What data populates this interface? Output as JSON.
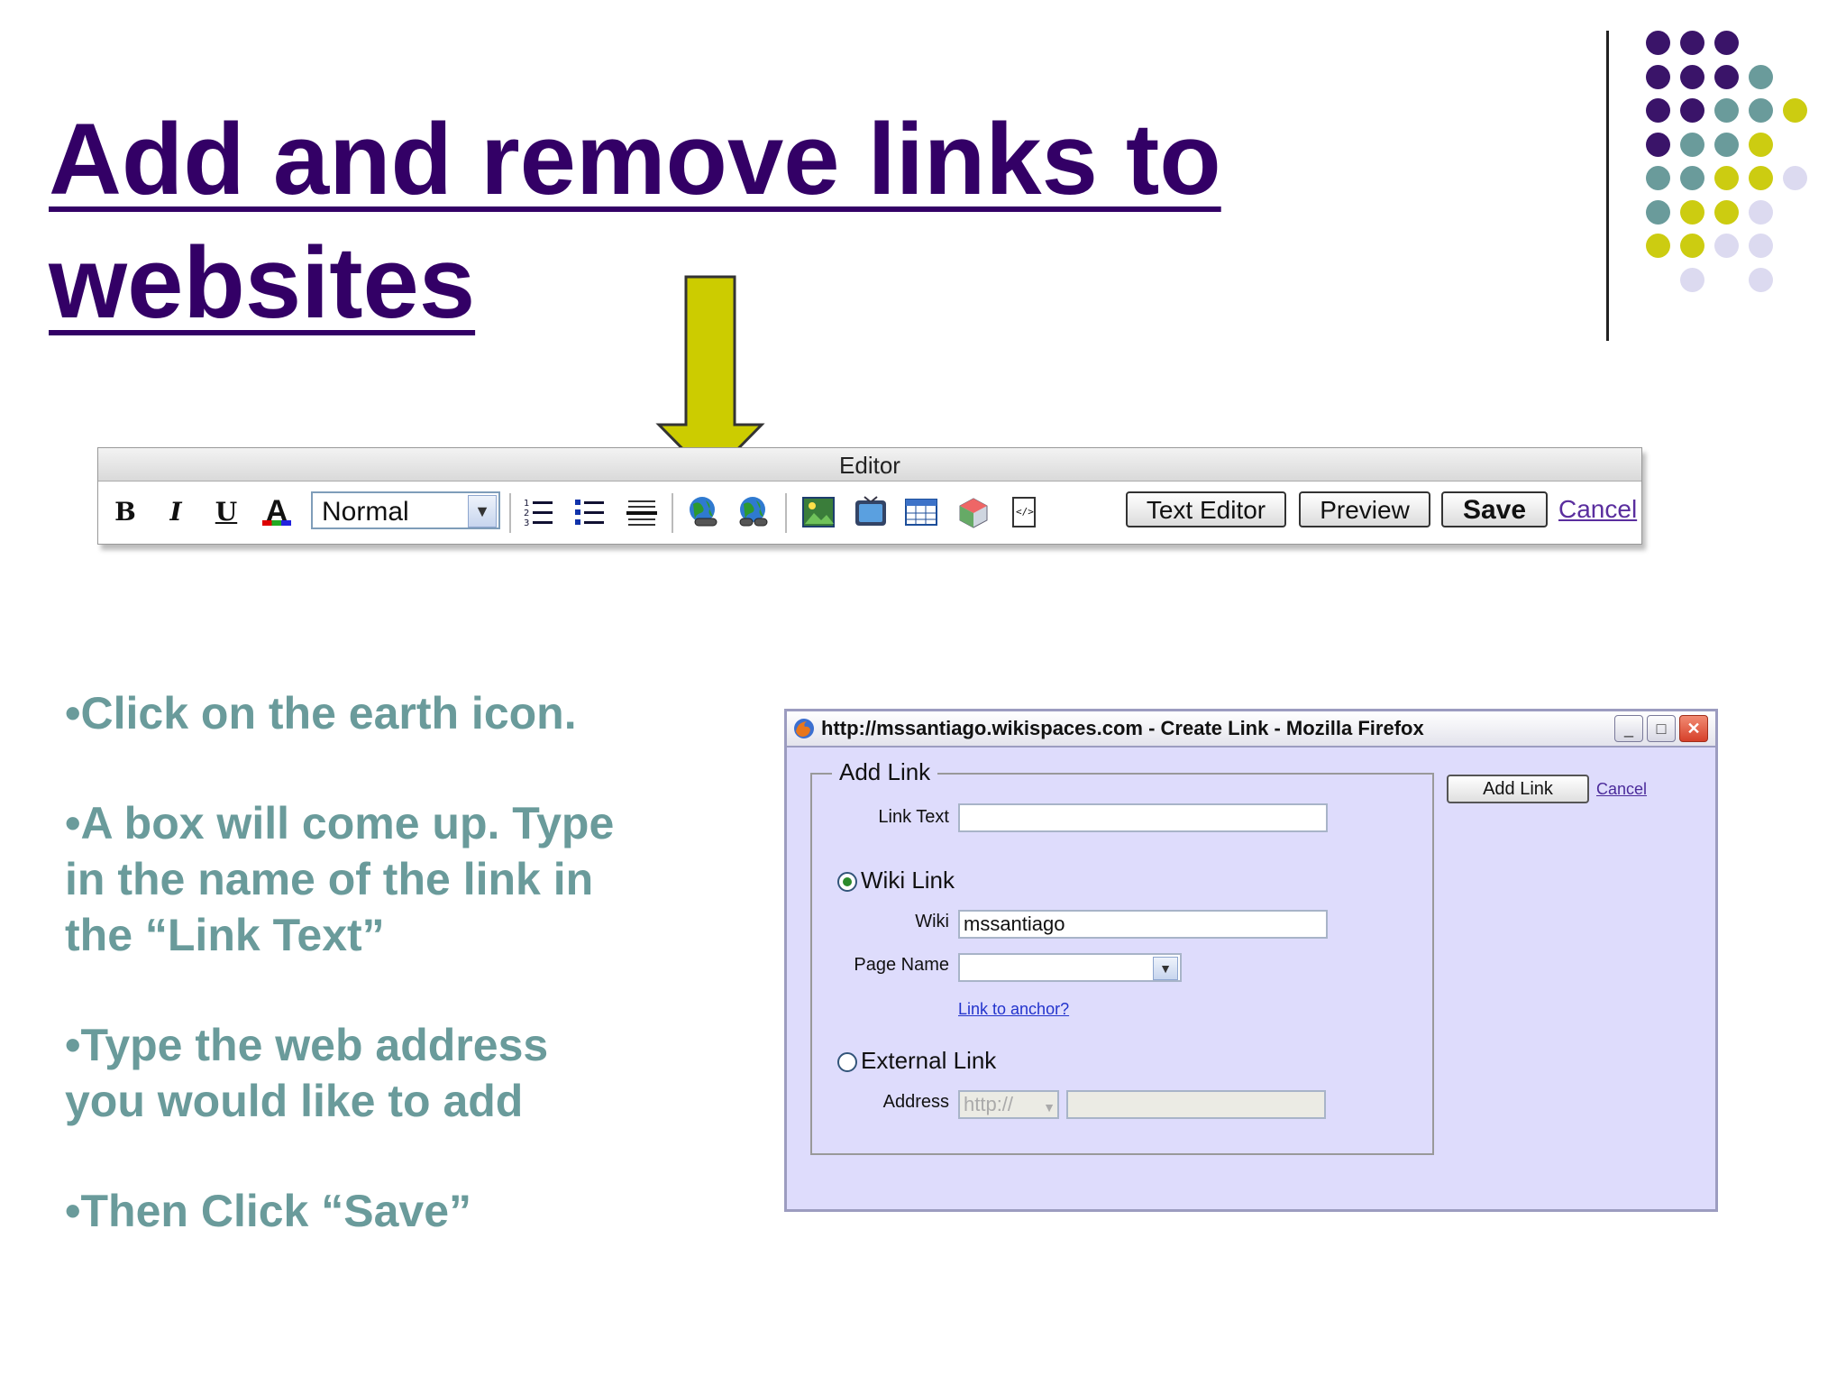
{
  "slide": {
    "title": "Add and remove links to websites",
    "colors": {
      "title": "#330066",
      "bullet_text": "#6a9b9b",
      "arrow": "#cccc00"
    }
  },
  "bullets": [
    "•Click on the earth icon.",
    "•A box will come up. Type in the name of the link in the “Link Text”",
    "•Type the web address you would like to add",
    "•Then Click “Save”"
  ],
  "editor": {
    "header": "Editor",
    "bold": "B",
    "italic": "I",
    "underline": "U",
    "font_color": "A",
    "style_select": "Normal",
    "buttons": {
      "text_editor": "Text Editor",
      "preview": "Preview",
      "save": "Save",
      "cancel": "Cancel"
    }
  },
  "dialog": {
    "window_title": "http://mssantiago.wikispaces.com - Create Link - Mozilla Firefox",
    "window_buttons": {
      "minimize": "_",
      "maximize": "□",
      "close": "✕"
    },
    "legend": "Add Link",
    "link_text_label": "Link Text",
    "link_text_value": "",
    "wiki_link_label": "Wiki Link",
    "wiki_label": "Wiki",
    "wiki_value": "mssantiago",
    "page_name_label": "Page Name",
    "link_to_anchor": "Link to anchor?",
    "external_link_label": "External Link",
    "address_label": "Address",
    "address_protocol": "http://",
    "address_value": "",
    "add_link_button": "Add Link",
    "cancel_link": "Cancel"
  }
}
